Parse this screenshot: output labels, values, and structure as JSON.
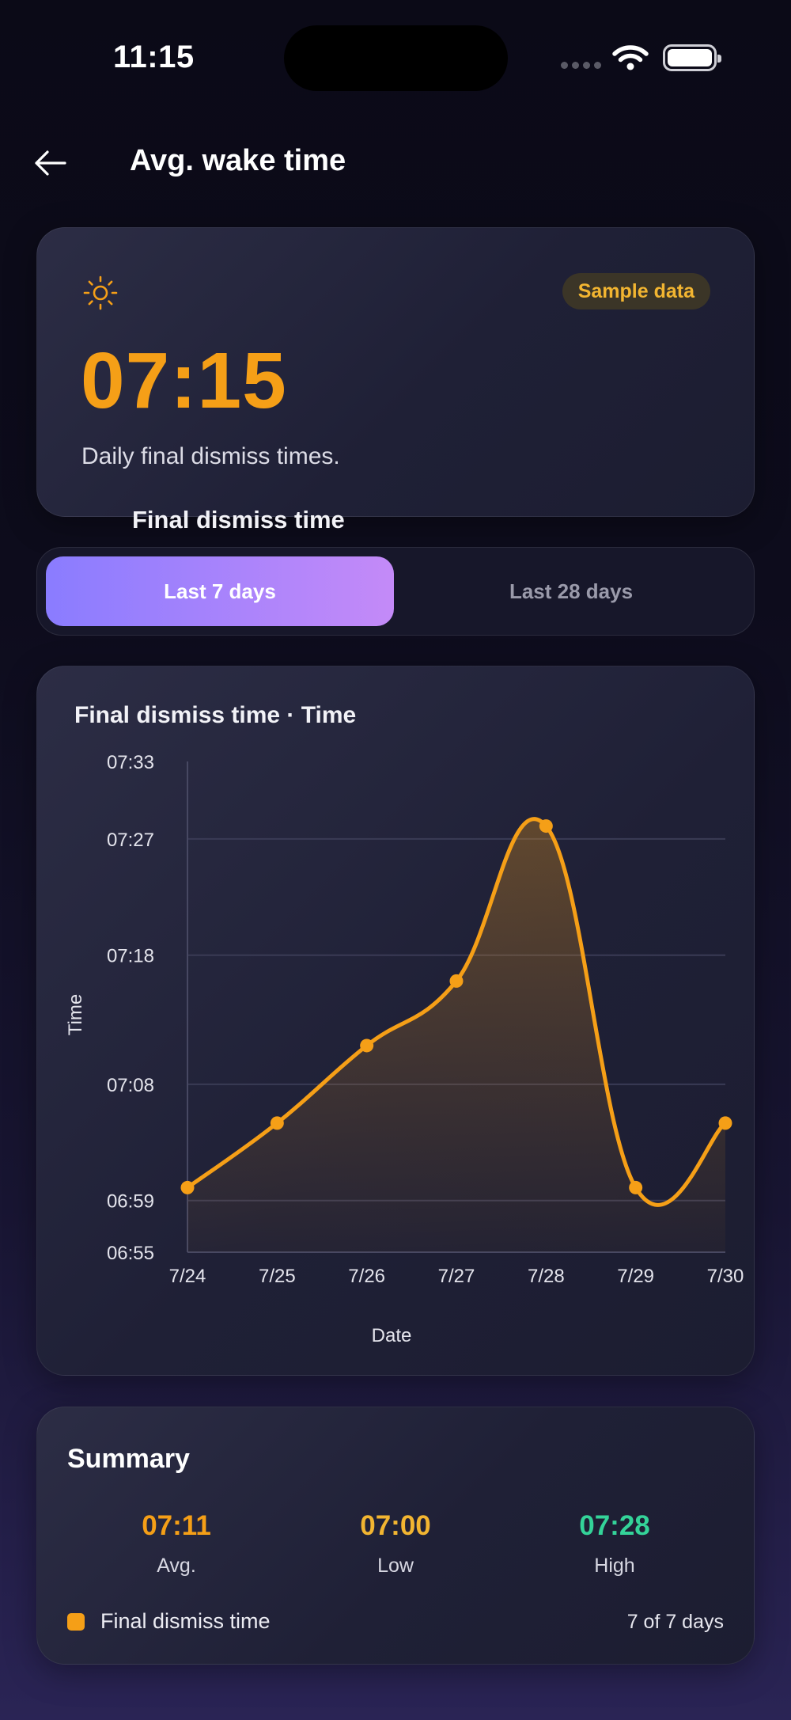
{
  "status_bar": {
    "time": "11:15"
  },
  "header": {
    "title": "Avg. wake time"
  },
  "hero": {
    "label": "Final dismiss time",
    "badge": "Sample data",
    "value": "07:15",
    "description": "Daily final dismiss times."
  },
  "segment": {
    "options": [
      "Last 7 days",
      "Last 28 days"
    ],
    "selected": "Last 7 days"
  },
  "chart": {
    "title": "Final dismiss time · Time",
    "color": "#f59f17"
  },
  "chart_data": {
    "type": "line",
    "title": "Final dismiss time · Time",
    "xlabel": "Date",
    "ylabel": "Time",
    "categories": [
      "7/24",
      "7/25",
      "7/26",
      "7/27",
      "7/28",
      "7/29",
      "7/30"
    ],
    "series": [
      {
        "name": "Final dismiss time",
        "values": [
          "07:00",
          "07:05",
          "07:11",
          "07:16",
          "07:28",
          "07:00",
          "07:05"
        ]
      }
    ],
    "y_tick_labels": [
      "07:33",
      "07:27",
      "07:18",
      "07:08",
      "06:59",
      "06:55"
    ],
    "ylim": [
      "06:55",
      "07:33"
    ],
    "grid": true,
    "area_fill": true
  },
  "summary": {
    "title": "Summary",
    "stats": [
      {
        "value": "07:11",
        "label": "Avg.",
        "color": "#f59f17"
      },
      {
        "value": "07:00",
        "label": "Low",
        "color": "#f2b531"
      },
      {
        "value": "07:28",
        "label": "High",
        "color": "#34d399"
      }
    ],
    "legend": "Final dismiss time",
    "days": "7 of 7 days"
  }
}
